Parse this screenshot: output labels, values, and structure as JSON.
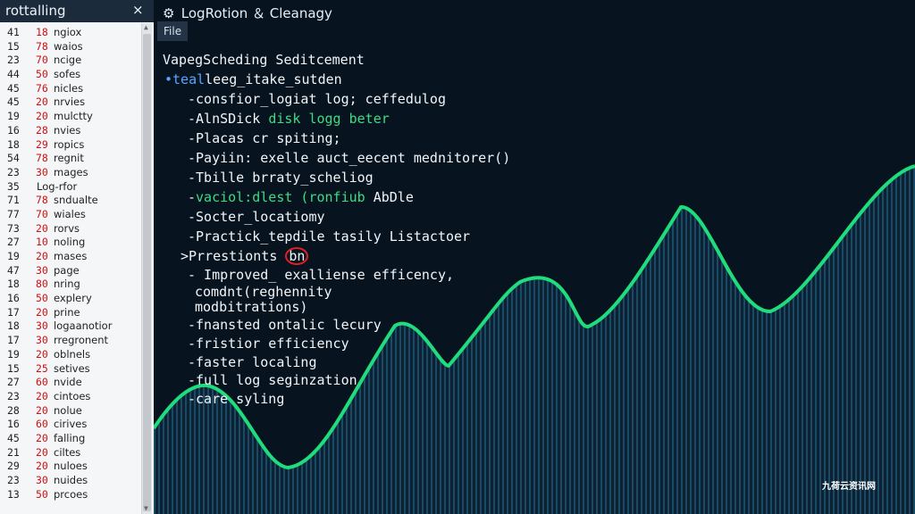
{
  "left_panel": {
    "title": "rottalling",
    "close_label": "×",
    "rows": [
      {
        "a": "41",
        "b": "18",
        "c": "ngiox"
      },
      {
        "a": "15",
        "b": "78",
        "c": "waios"
      },
      {
        "a": "23",
        "b": "70",
        "c": "ncige"
      },
      {
        "a": "44",
        "b": "50",
        "c": "sofes"
      },
      {
        "a": "45",
        "b": "76",
        "c": "nicles"
      },
      {
        "a": "45",
        "b": "20",
        "c": "nrvies"
      },
      {
        "a": "19",
        "b": "20",
        "c": "mulctty"
      },
      {
        "a": "16",
        "b": "28",
        "c": "nvies"
      },
      {
        "a": "18",
        "b": "29",
        "c": "ropics"
      },
      {
        "a": "54",
        "b": "78",
        "c": "regnit"
      },
      {
        "a": "23",
        "b": "30",
        "c": "mages"
      },
      {
        "a": "35",
        "b": "",
        "c": "Log-rfor",
        "note": true
      },
      {
        "a": "71",
        "b": "78",
        "c": "sndualte"
      },
      {
        "a": "77",
        "b": "70",
        "c": "wiales"
      },
      {
        "a": "73",
        "b": "20",
        "c": "rorvs"
      },
      {
        "a": "27",
        "b": "10",
        "c": "noling"
      },
      {
        "a": "19",
        "b": "20",
        "c": "mases"
      },
      {
        "a": "47",
        "b": "30",
        "c": "page"
      },
      {
        "a": "18",
        "b": "80",
        "c": "nring"
      },
      {
        "a": "16",
        "b": "50",
        "c": "explery"
      },
      {
        "a": "17",
        "b": "20",
        "c": "prine"
      },
      {
        "a": "18",
        "b": "30",
        "c": "logaanotior"
      },
      {
        "a": "17",
        "b": "30",
        "c": "rregronent"
      },
      {
        "a": "19",
        "b": "20",
        "c": "oblnels"
      },
      {
        "a": "15",
        "b": "25",
        "c": "setives"
      },
      {
        "a": "27",
        "b": "60",
        "c": "nvide"
      },
      {
        "a": "23",
        "b": "20",
        "c": "cintoes"
      },
      {
        "a": "28",
        "b": "20",
        "c": "nolue"
      },
      {
        "a": "16",
        "b": "60",
        "c": "cirives"
      },
      {
        "a": "45",
        "b": "20",
        "c": "falling"
      },
      {
        "a": "21",
        "b": "20",
        "c": "ciltes"
      },
      {
        "a": "29",
        "b": "20",
        "c": "nuloes"
      },
      {
        "a": "23",
        "b": "30",
        "c": "nuides"
      },
      {
        "a": "13",
        "b": "50",
        "c": "prcoes"
      }
    ]
  },
  "editor": {
    "title": "LogRotion ＆ Cleanagy",
    "gear_glyph": "⚙",
    "menu_file": "File",
    "lines": {
      "l1": "VapegScheding Seditcement",
      "l2_bullet": "•",
      "l2_teal": "teal",
      "l2_rest": "leeg_itake_sutden",
      "l3": "-consfior_logiat log; ceffedulog",
      "l4_a": "-AlnSDick ",
      "l4_b": "disk logg beter",
      "l5": "-Placas cr spiting;",
      "l6": "-Payiin: exelle auct_eecent mednitorer()",
      "l7": "-Tbille brraty_scheliog",
      "l8_a": "-",
      "l8_b": "vaciol:dlest (ronfiub",
      "l8_c": " AbDle",
      "l9": "-Socter_locatiomy",
      "l10": "-Practick_tepdile tasily Listactoer",
      "l11_a": ">Prrestionts ",
      "l11_b": "bn",
      "l12": "- Improved_ exalliense efficency,",
      "l13": "comdnt(reghennity",
      "l14": "modbitrations)",
      "l15": "-fnansted ontalic lecury",
      "l16": "-fristior efficiency",
      "l17": "-faster localing",
      "l18": "-full log seginzation",
      "l19": "-care syling"
    }
  },
  "watermark": "九荷云资讯网",
  "colors": {
    "wave": "#1fdc7c",
    "keyword_green": "#3ddc84",
    "keyword_blue": "#55a8ff",
    "line_number_red": "#d01010",
    "highlight_circle": "#e02020"
  }
}
